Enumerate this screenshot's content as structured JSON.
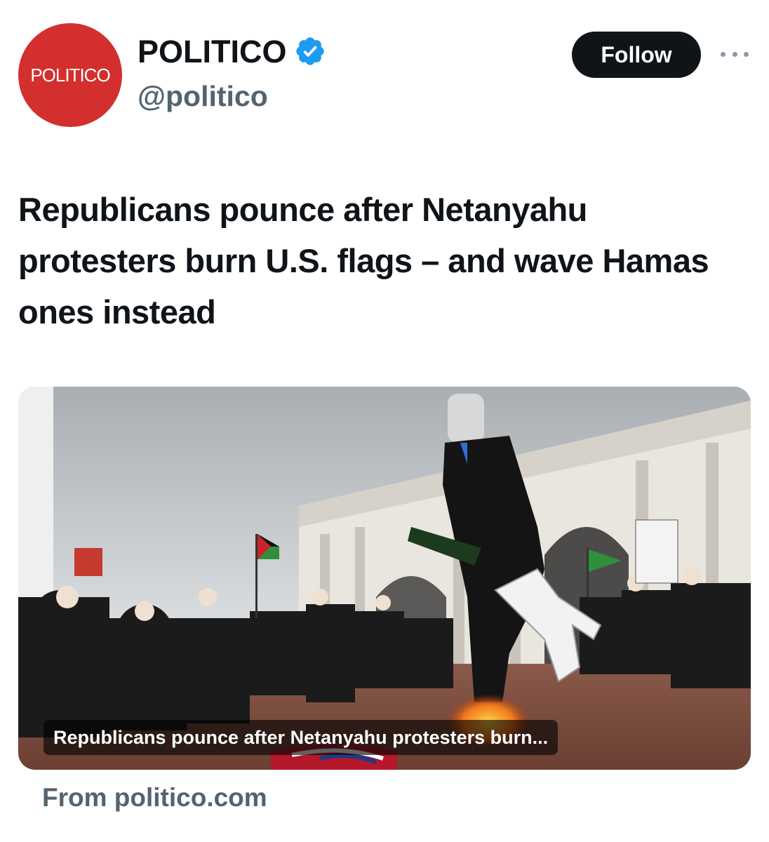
{
  "account": {
    "avatar_text": "POLITICO",
    "display_name": "POLITICO",
    "handle": "@politico",
    "verified_icon": "verified-badge-icon",
    "follow_label": "Follow",
    "more_icon": "more-options-icon"
  },
  "tweet": {
    "headline": "Republicans pounce after Netanyahu protesters burn U.S. flags – and wave Hamas ones instead"
  },
  "card": {
    "image_description_icon": "news-photo",
    "caption": "Republicans pounce after Netanyahu protesters burn...",
    "source": "From politico.com"
  },
  "colors": {
    "avatar_bg": "#d32f2f",
    "follow_bg": "#0f1419",
    "verified": "#1d9bf0",
    "secondary_text": "#536471"
  }
}
